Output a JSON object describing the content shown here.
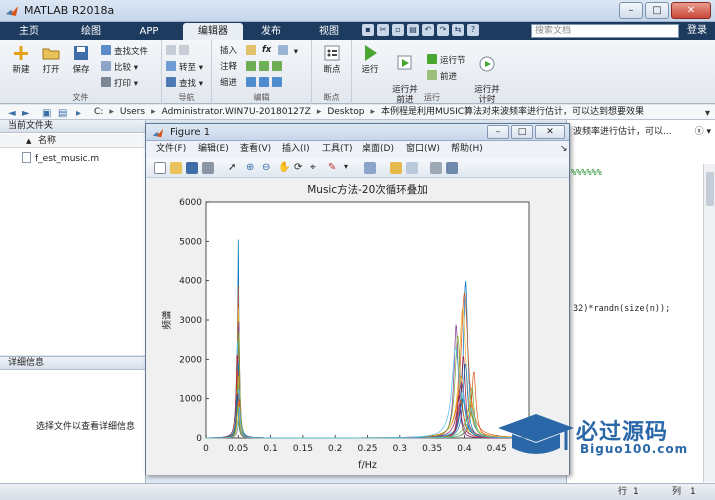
{
  "window": {
    "title": "MATLAB R2018a"
  },
  "window_buttons": {
    "minimize": "–",
    "maximize": "□",
    "close": "✕"
  },
  "tabs": [
    {
      "label": "主页"
    },
    {
      "label": "绘图"
    },
    {
      "label": "APP"
    },
    {
      "label": "编辑器"
    },
    {
      "label": "发布"
    },
    {
      "label": "视图"
    }
  ],
  "search": {
    "placeholder": "搜索文档"
  },
  "login": {
    "label": "登录"
  },
  "ribbon": {
    "file_group": {
      "label": "文件",
      "new": "新建",
      "open": "打开",
      "save": "保存",
      "find_files": "查找文件",
      "compare": "比较",
      "print": "打印"
    },
    "nav_group": {
      "label": "导航",
      "goto": "转至",
      "find": "查找"
    },
    "edit_group": {
      "label": "编辑",
      "insert": "插入",
      "comment": "注释",
      "indent": "缩进",
      "fx": "fx"
    },
    "breakpoint_group": {
      "label": "断点",
      "breakpoint": "断点"
    },
    "run_group": {
      "label": "运行",
      "run": "运行",
      "run_advance": "运行并\n前进",
      "run_section": "运行节",
      "advance": "前进",
      "run_time": "运行并\n计时"
    }
  },
  "path": {
    "crumbs": [
      "C:",
      "Users",
      "Administrator.WIN7U-20180127Z",
      "Desktop",
      "本例程是利用MUSIC算法对来波频率进行估计，可以达到想要效果"
    ]
  },
  "current_folder": {
    "title": "当前文件夹",
    "column_name": "名称",
    "sort_indicator": "▲",
    "files": [
      "f_est_music.m"
    ]
  },
  "details": {
    "title": "详细信息",
    "hint": "选择文件以查看详细信息"
  },
  "editor": {
    "title": "波频率进行估计，可以...",
    "line1": "%%%%%%",
    "line2": "32)*randn(size(n));"
  },
  "statusbar": {
    "row_label": "行",
    "row_value": "1",
    "col_label": "列",
    "col_value": "1"
  },
  "figure": {
    "title": "Figure 1",
    "menu": [
      "文件(F)",
      "编辑(E)",
      "查看(V)",
      "插入(I)",
      "工具(T)",
      "桌面(D)",
      "窗口(W)",
      "帮助(H)"
    ]
  },
  "chart_data": {
    "type": "line",
    "title": "Music方法-20次循环叠加",
    "xlabel": "f/Hz",
    "ylabel": "频谱",
    "xlim": [
      0,
      0.5
    ],
    "ylim": [
      0,
      6000
    ],
    "xticks": [
      "0",
      "0.05",
      "0.1",
      "0.15",
      "0.2",
      "0.25",
      "0.3",
      "0.35",
      "0.4",
      "0.45"
    ],
    "xtick_values": [
      0,
      0.05,
      0.1,
      0.15,
      0.2,
      0.25,
      0.3,
      0.35,
      0.4,
      0.45
    ],
    "yticks": [
      "0",
      "1000",
      "2000",
      "3000",
      "4000",
      "5000",
      "6000"
    ],
    "ytick_values": [
      0,
      1000,
      2000,
      3000,
      4000,
      5000,
      6000
    ],
    "grid": false,
    "series_count": 20,
    "peaks": [
      {
        "center": 0.05,
        "heights": [
          5050,
          4000,
          3500,
          3100,
          2800,
          2500,
          2200,
          2000,
          1800,
          1600,
          1500,
          1400,
          1300,
          1200,
          1100,
          1000,
          950,
          900,
          850,
          800
        ]
      },
      {
        "center": 0.4,
        "heights": [
          4000,
          3700,
          3300,
          2900,
          2600,
          2300,
          2100,
          1900,
          1700,
          1550,
          1400,
          1300,
          1200,
          1100,
          1000,
          950,
          900,
          850,
          800,
          750
        ]
      }
    ],
    "colors": [
      "#0072bd",
      "#d95319",
      "#edb120",
      "#7e2f8e",
      "#77ac30",
      "#4dbeee",
      "#a2142f"
    ]
  },
  "watermark": {
    "text": "必过源码",
    "sub": "Biguo100.com"
  }
}
